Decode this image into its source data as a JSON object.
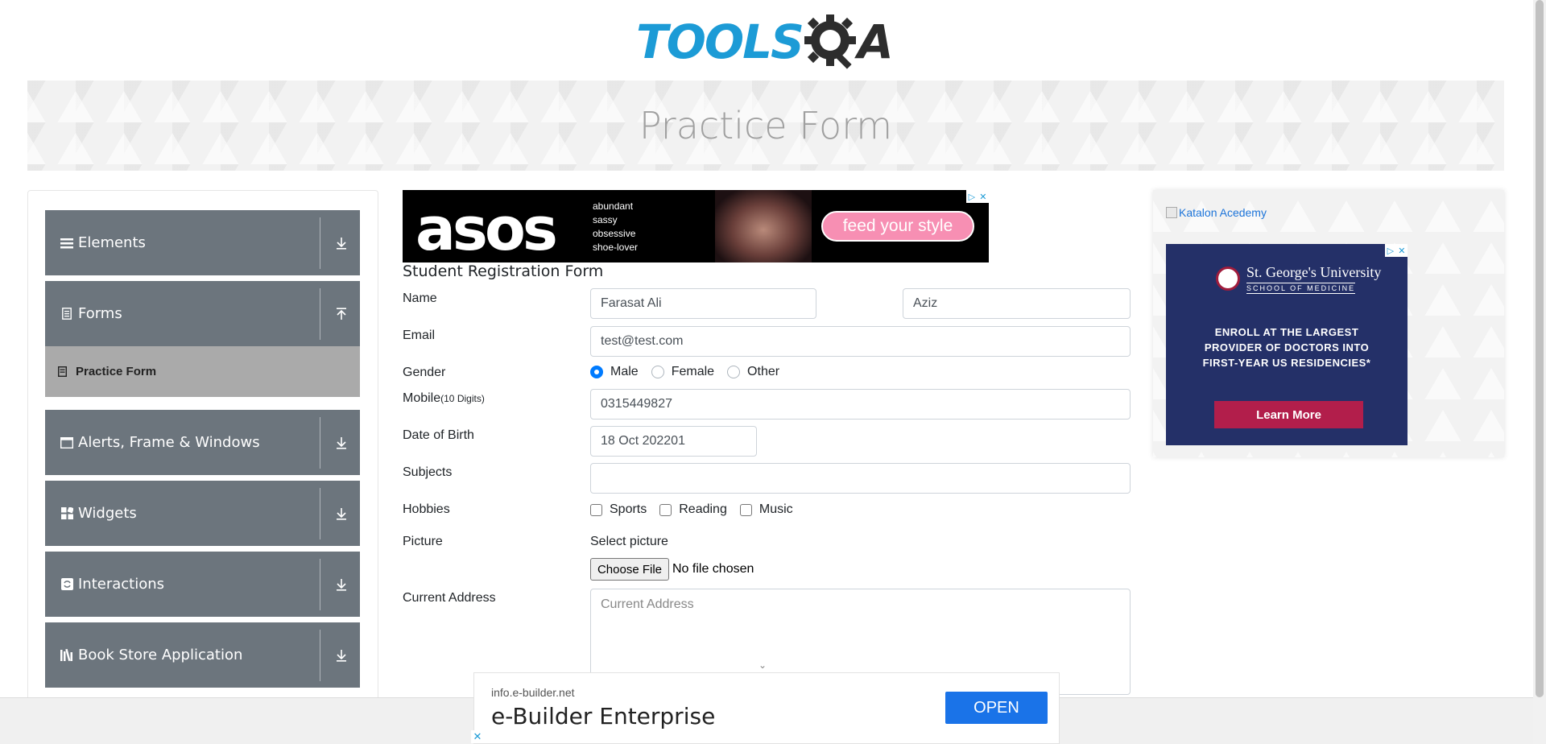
{
  "header": {
    "logo_blue": "TOOLS",
    "logo_dark": "A",
    "logo_alt": "TOOLSQA"
  },
  "banner": {
    "title": "Practice Form"
  },
  "sidebar": {
    "groups": [
      {
        "label": "Elements",
        "icon": "hamburger-icon",
        "arrow": "expand-icon"
      },
      {
        "label": "Forms",
        "icon": "form-icon",
        "arrow": "collapse-icon"
      },
      {
        "label": "Alerts, Frame & Windows",
        "icon": "window-icon",
        "arrow": "expand-icon"
      },
      {
        "label": "Widgets",
        "icon": "widgets-icon",
        "arrow": "expand-icon"
      },
      {
        "label": "Interactions",
        "icon": "interactions-icon",
        "arrow": "expand-icon"
      },
      {
        "label": "Book Store Application",
        "icon": "books-icon",
        "arrow": "expand-icon"
      }
    ],
    "active_item": {
      "label": "Practice Form"
    }
  },
  "ad_top": {
    "brand": "asos",
    "tags": [
      "abundant",
      "sassy",
      "obsessive",
      "shoe-lover"
    ],
    "cta": "feed your style"
  },
  "form": {
    "title": "Student Registration Form",
    "name": {
      "label": "Name",
      "first": "Farasat Ali",
      "last": "Aziz"
    },
    "email": {
      "label": "Email",
      "value": "test@test.com"
    },
    "gender": {
      "label": "Gender",
      "options": [
        "Male",
        "Female",
        "Other"
      ],
      "selected": "Male"
    },
    "mobile": {
      "label": "Mobile",
      "hint": "(10 Digits)",
      "value": "0315449827"
    },
    "dob": {
      "label": "Date of Birth",
      "value": "18 Oct 202201"
    },
    "subjects": {
      "label": "Subjects",
      "value": ""
    },
    "hobbies": {
      "label": "Hobbies",
      "options": [
        "Sports",
        "Reading",
        "Music"
      ]
    },
    "picture": {
      "label": "Picture",
      "select_label": "Select picture",
      "button": "Choose File",
      "status": "No file chosen"
    },
    "address": {
      "label": "Current Address",
      "placeholder": "Current Address"
    }
  },
  "right_ad": {
    "broken_alt": "Katalon Acedemy",
    "university": "St. George's University",
    "school": "SCHOOL OF MEDICINE",
    "message_lines": [
      "ENROLL AT THE LARGEST",
      "PROVIDER OF DOCTORS INTO",
      "FIRST-YEAR US RESIDENCIES*"
    ],
    "cta": "Learn More"
  },
  "bottom_ad": {
    "domain": "info.e-builder.net",
    "brand": "e-Builder Enterprise",
    "cta": "OPEN"
  },
  "colors": {
    "primary": "#007bff",
    "sidebar_group": "#6c757d",
    "sidebar_active": "#aaaaaa",
    "logo_blue": "#1c9bd6"
  }
}
